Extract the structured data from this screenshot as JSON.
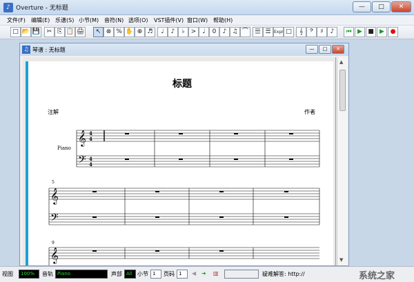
{
  "window": {
    "title": "Overture - 无标题",
    "controls": [
      "—",
      "□",
      "✕"
    ]
  },
  "menu": [
    "文件(F)",
    "编辑(E)",
    "乐谱(S)",
    "小节(M)",
    "音符(N)",
    "选项(O)",
    "VST插件(V)",
    "窗口(W)",
    "帮助(H)"
  ],
  "toolbar": {
    "glyphs": [
      "□",
      "📂",
      "💾",
      "✂",
      "⎘",
      "📋",
      "🖨",
      "↖",
      "⊗",
      "%",
      "✋",
      "⊕",
      "♬",
      "♩",
      "♪",
      "♭",
      ">",
      "♩",
      "0",
      "♪",
      "♫",
      "⌒",
      "𝄚",
      "☰",
      "Expr",
      "□",
      "𝄞",
      "𝄢",
      "♯",
      "♪",
      "⏮",
      "▶",
      "■",
      "▶",
      "●"
    ]
  },
  "child": {
    "title": "琴谱 : 无标题",
    "controls": [
      "—",
      "□",
      "✕"
    ]
  },
  "score": {
    "title": "标题",
    "annotation": "注解",
    "composer": "作者",
    "instrument": "Piano",
    "time_signature": "4/4",
    "measure_numbers": [
      "5",
      "9"
    ]
  },
  "statusbar": {
    "view_label": "视图",
    "zoom": "100%",
    "track_label": "音轨",
    "track_value": "Piano",
    "voice_label": "声部",
    "voice_value": "All",
    "measure_label": "小节",
    "measure_value": "1",
    "page_label": "页码",
    "page_value": "1",
    "hint_label": "疑难解答: http://",
    "watermark": "系统之家"
  },
  "colors": {
    "accent": "#1aa2d8",
    "status_text": "#2fd33a",
    "mdi_bg": "#c7d7e8"
  }
}
